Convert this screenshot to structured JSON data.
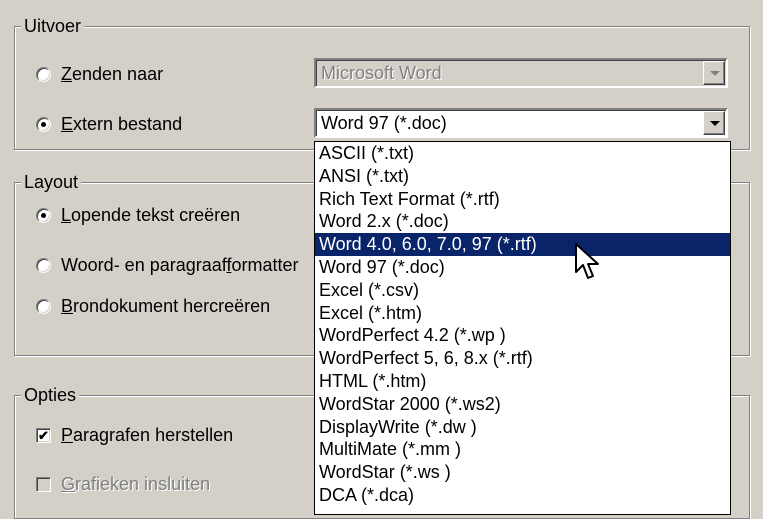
{
  "output_group": {
    "title": "Uitvoer",
    "send_to": {
      "key": "Z",
      "rest": "enden naar",
      "checked": false
    },
    "send_to_target": "Microsoft Word",
    "extern_file": {
      "key": "E",
      "rest": "xtern bestand",
      "checked": true
    },
    "format_value": "Word 97 (*.doc)"
  },
  "layout_group": {
    "title": "Layout",
    "options": [
      {
        "key": "L",
        "rest": "opende tekst creëren",
        "checked": true
      },
      {
        "pre": "Woord- en paragraaf",
        "key": "f",
        "rest": "ormatter",
        "checked": false
      },
      {
        "key": "B",
        "rest": "rondokument hercreëren",
        "checked": false
      }
    ]
  },
  "options_group": {
    "title": "Opties",
    "restore_paragraphs": {
      "key": "P",
      "rest": "aragrafen herstellen",
      "checked": true
    },
    "embed_charts": {
      "key": "G",
      "rest": "rafieken insluiten",
      "checked": false,
      "disabled": true
    }
  },
  "format_list": {
    "items": [
      "ASCII (*.txt)",
      "ANSI (*.txt)",
      "Rich Text Format (*.rtf)",
      "Word 2.x (*.doc)",
      "Word 4.0, 6.0, 7.0, 97 (*.rtf)",
      "Word 97 (*.doc)",
      "Excel (*.csv)",
      "Excel (*.htm)",
      "WordPerfect 4.2 (*.wp )",
      "WordPerfect 5, 6, 8.x (*.rtf)",
      "HTML (*.htm)",
      "WordStar 2000 (*.ws2)",
      "DisplayWrite (*.dw )",
      "MultiMate (*.mm )",
      "WordStar (*.ws )",
      "DCA (*.dca)"
    ],
    "selected_index": 4
  }
}
